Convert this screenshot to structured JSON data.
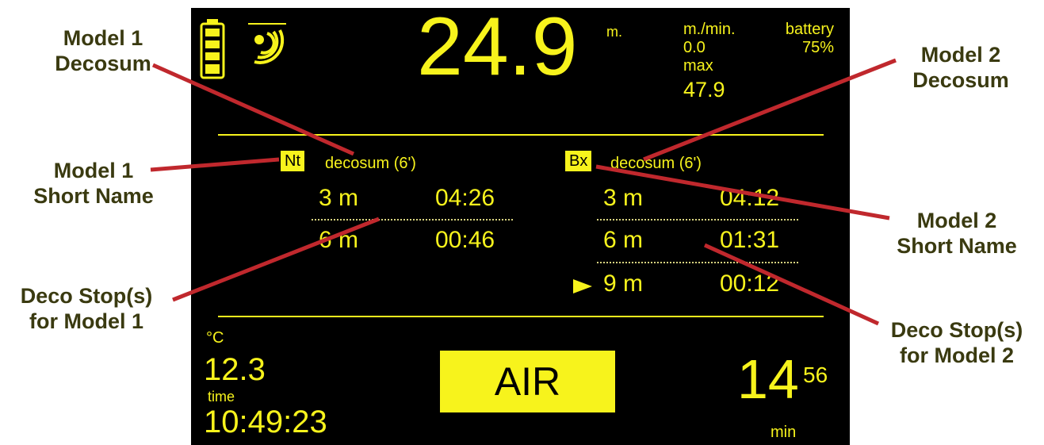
{
  "depth": {
    "value": "24.9",
    "unit": "m."
  },
  "ascent": {
    "label": "m./min.",
    "value": "0.0"
  },
  "max_depth": {
    "label": "max",
    "value": "47.9"
  },
  "battery": {
    "label": "battery",
    "value": "75%"
  },
  "model1": {
    "short_name": "Nt",
    "decosum_label": "decosum (6')",
    "stops": [
      {
        "depth": "3 m",
        "time": "04:26"
      },
      {
        "depth": "6 m",
        "time": "00:46"
      }
    ]
  },
  "model2": {
    "short_name": "Bx",
    "decosum_label": "decosum (6')",
    "stops": [
      {
        "depth": "3 m",
        "time": "04:12"
      },
      {
        "depth": "6 m",
        "time": "01:31"
      },
      {
        "depth": "9 m",
        "time": "00:12",
        "current": true
      }
    ]
  },
  "temperature": {
    "unit": "°C",
    "value": "12.3"
  },
  "clock": {
    "label": "time",
    "value": "10:49:23"
  },
  "gas": {
    "label": "AIR"
  },
  "dive_time": {
    "minutes": "14",
    "seconds": "56",
    "unit": "min"
  },
  "annotations": {
    "model1_decosum": [
      "Model 1",
      "Decosum"
    ],
    "model1_short": [
      "Model 1",
      "Short Name"
    ],
    "model1_stops": [
      "Deco Stop(s)",
      "for Model 1"
    ],
    "model2_decosum": [
      "Model 2",
      "Decosum"
    ],
    "model2_short": [
      "Model 2",
      "Short Name"
    ],
    "model2_stops": [
      "Deco Stop(s)",
      "for Model 2"
    ]
  },
  "colors": {
    "display": "#f7f31c",
    "background": "#000000",
    "annotation_line": "#c0282d",
    "annotation_text": "#3a3a10"
  },
  "icons": [
    "battery-icon",
    "sonar-signal-icon",
    "current-stop-arrow-icon"
  ]
}
